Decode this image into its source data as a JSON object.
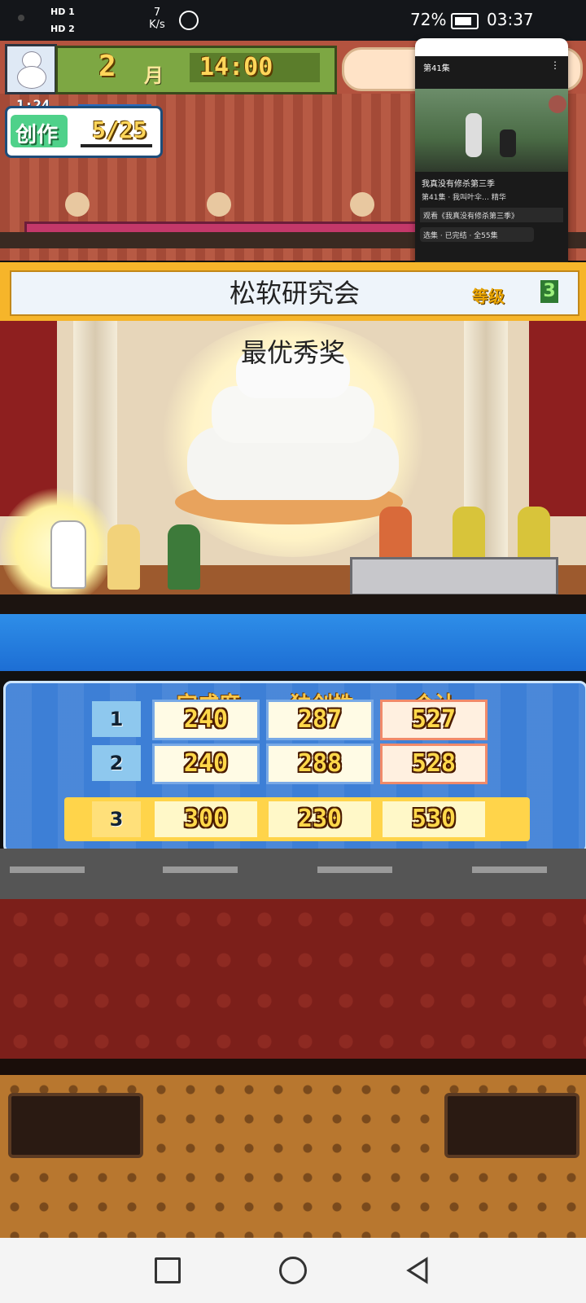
{
  "status_bar": {
    "hd1": "HD 1",
    "hd2": "HD 2",
    "speed_value": "7",
    "speed_unit": "K/s",
    "battery": "72%",
    "time": "03:37"
  },
  "game_header": {
    "month_number": "2",
    "month_label": "月",
    "clock": "14:00",
    "timer": "1:24",
    "task_label": "创作",
    "task_progress": "5/25"
  },
  "mini_window": {
    "episode": "第41集",
    "show_title": "我真没有修杀第三季",
    "subtitle": "第41集 · 我叫叶伞…  精华",
    "now_watching": "观看《我真没有修杀第三季》",
    "episodes": "选集 · 已完结 · 全55集"
  },
  "title_banner": {
    "title": "松软研究会",
    "level_label": "等级",
    "level_value": "3"
  },
  "stage": {
    "award": "最优秀奖"
  },
  "score_table": {
    "headers": [
      "完成度",
      "独创性",
      "合计"
    ],
    "rows": [
      {
        "rank": "1",
        "completion": "240",
        "originality": "287",
        "total": "527"
      },
      {
        "rank": "2",
        "completion": "240",
        "originality": "288",
        "total": "528"
      },
      {
        "rank": "3",
        "completion": "300",
        "originality": "230",
        "total": "530"
      }
    ]
  },
  "colors": {
    "banner_gold": "#f6b52a",
    "panel_blue": "#3d7fd6",
    "highlight_row": "#ffd44a"
  },
  "icons": [
    "snowman-icon",
    "battery-icon",
    "square-nav-icon",
    "circle-nav-icon",
    "back-nav-icon"
  ]
}
